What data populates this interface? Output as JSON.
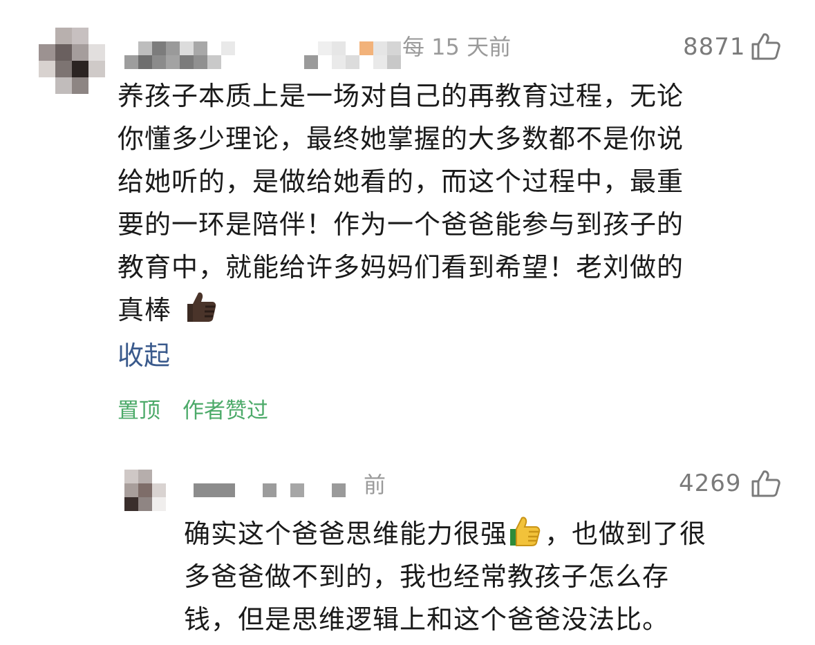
{
  "comments": [
    {
      "time": "每 15 天前",
      "likes": "8871",
      "text_lines": [
        "养孩子本质上是一场对自己的再教育过程，无论",
        "你懂多少理论，最终她掌握的大多数都不是你说",
        "给她听的，是做给她看的，而这个过程中，最重",
        "要的一环是陪伴！作为一个爸爸能参与到孩子的",
        "教育中，就能给许多妈妈们看到希望！老刘做的",
        "真棒"
      ],
      "collapse_label": "收起",
      "tags": [
        "置顶",
        "作者赞过"
      ],
      "emoji": "thumbs-up-dark"
    },
    {
      "time": "前",
      "likes": "4269",
      "text_lines": [
        "确实这个爸爸思维能力很强",
        "，也做到了很",
        "多爸爸做不到的，我也经常教孩子怎么存",
        "钱，但是思维逻辑上和这个爸爸没法比。"
      ],
      "emoji": "thumbs-up-light"
    }
  ],
  "icons": {
    "like": "thumbs-up-outline-icon",
    "avatar": "avatar-blurred"
  },
  "colors": {
    "link": "#3a5a8c",
    "tag_green": "#4caa69",
    "meta_gray": "#9a9a9a"
  }
}
